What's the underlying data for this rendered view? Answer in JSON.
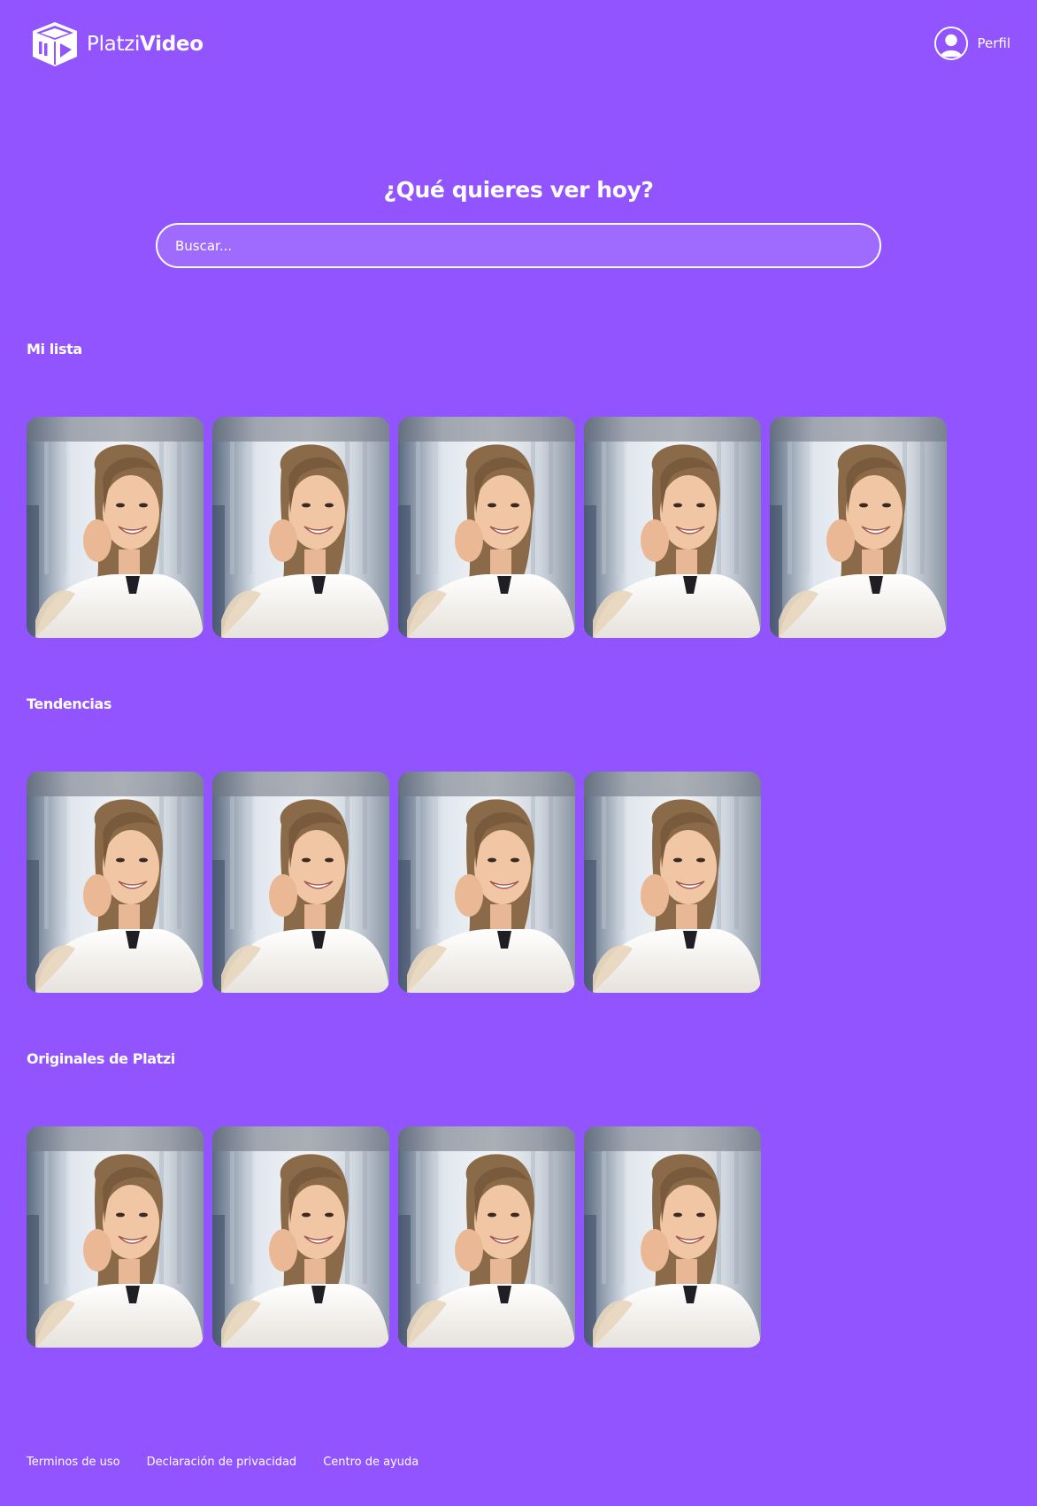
{
  "header": {
    "brand_part1": "Platzi",
    "brand_part2": "Video",
    "profile_label": "Perfil"
  },
  "hero": {
    "title": "¿Qué quieres ver hoy?",
    "search_placeholder": "Buscar..."
  },
  "sections": [
    {
      "title": "Mi lista",
      "card_count": 5
    },
    {
      "title": "Tendencias",
      "card_count": 4
    },
    {
      "title": "Originales de Platzi",
      "card_count": 4
    }
  ],
  "footer": {
    "links": [
      "Terminos de uso",
      "Declaración de privacidad",
      "Centro de ayuda"
    ]
  },
  "colors": {
    "background": "#9154ff",
    "search_fill": "#9f6bff",
    "text": "#ffffff"
  },
  "icons": {
    "logo": "cube-play-logo-icon",
    "profile": "user-avatar-icon"
  }
}
